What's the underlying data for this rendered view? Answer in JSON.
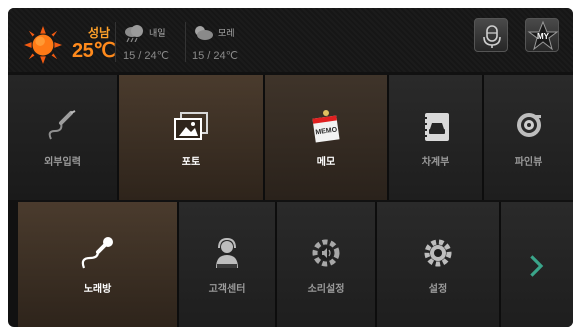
{
  "weather": {
    "city": "성남",
    "temperature": "25℃",
    "forecast": [
      {
        "day": "내일",
        "temp": "15 / 24℃",
        "icon": "rain-cloud-icon"
      },
      {
        "day": "모레",
        "temp": "15 / 24℃",
        "icon": "cloud-sun-icon"
      }
    ]
  },
  "topbar": {
    "voice_icon": "microphone-icon",
    "my_label": "MY"
  },
  "tiles_row1": [
    {
      "label": "외부입력",
      "icon": "external-input-icon"
    },
    {
      "label": "포토",
      "icon": "photo-icon"
    },
    {
      "label": "메모",
      "icon": "memo-icon"
    },
    {
      "label": "차계부",
      "icon": "car-logbook-icon"
    },
    {
      "label": "파인뷰",
      "icon": "fineview-icon"
    }
  ],
  "tiles_row2": [
    {
      "label": "노래방",
      "icon": "karaoke-mic-icon"
    },
    {
      "label": "고객센터",
      "icon": "customer-center-icon"
    },
    {
      "label": "소리설정",
      "icon": "sound-settings-icon"
    },
    {
      "label": "설정",
      "icon": "gear-icon"
    },
    {
      "label": "",
      "icon": "chevron-right-icon"
    }
  ],
  "colors": {
    "accent": "#ff8a1c",
    "next_arrow": "#3aa58a",
    "background": "#111111"
  }
}
